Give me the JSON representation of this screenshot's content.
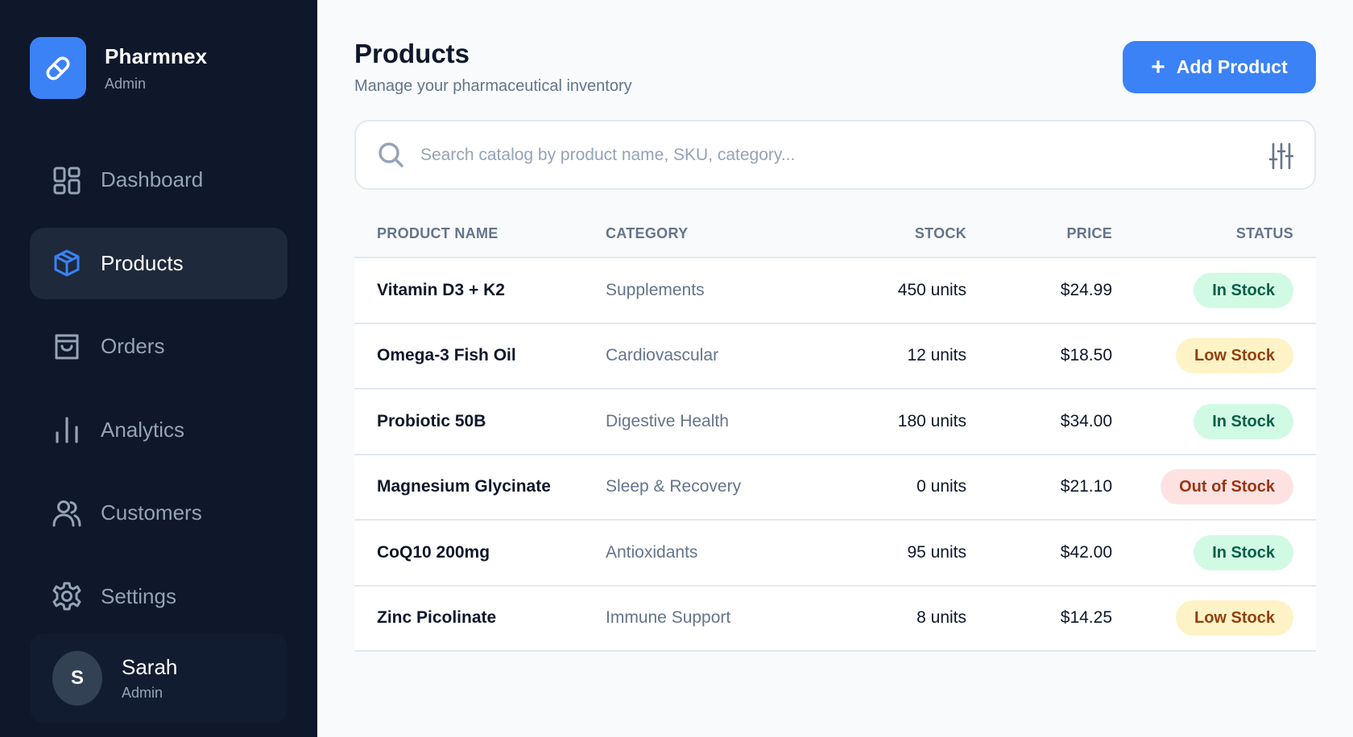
{
  "brand": {
    "name": "Pharmnex",
    "role": "Admin"
  },
  "nav": [
    {
      "label": "Dashboard",
      "icon": "dashboard-icon",
      "active": false
    },
    {
      "label": "Products",
      "icon": "box-icon",
      "active": true
    },
    {
      "label": "Orders",
      "icon": "shopping-bag-icon",
      "active": false
    },
    {
      "label": "Analytics",
      "icon": "bar-chart-icon",
      "active": false
    },
    {
      "label": "Customers",
      "icon": "users-icon",
      "active": false
    },
    {
      "label": "Settings",
      "icon": "gear-icon",
      "active": false
    }
  ],
  "user": {
    "initial": "S",
    "name": "Sarah",
    "role": "Admin"
  },
  "header": {
    "title": "Products",
    "subtitle": "Manage your pharmaceutical inventory",
    "add_button": "Add Product"
  },
  "search": {
    "placeholder": "Search catalog by product name, SKU, category...",
    "value": ""
  },
  "table": {
    "columns": [
      "PRODUCT NAME",
      "CATEGORY",
      "STOCK",
      "PRICE",
      "STATUS"
    ],
    "rows": [
      {
        "name": "Vitamin D3 + K2",
        "category": "Supplements",
        "stock": "450 units",
        "price": "$24.99",
        "status": "In Stock",
        "status_type": "in"
      },
      {
        "name": "Omega-3 Fish Oil",
        "category": "Cardiovascular",
        "stock": "12 units",
        "price": "$18.50",
        "status": "Low Stock",
        "status_type": "low"
      },
      {
        "name": "Probiotic 50B",
        "category": "Digestive Health",
        "stock": "180 units",
        "price": "$34.00",
        "status": "In Stock",
        "status_type": "in"
      },
      {
        "name": "Magnesium Glycinate",
        "category": "Sleep & Recovery",
        "stock": "0 units",
        "price": "$21.10",
        "status": "Out of Stock",
        "status_type": "out"
      },
      {
        "name": "CoQ10 200mg",
        "category": "Antioxidants",
        "stock": "95 units",
        "price": "$42.00",
        "status": "In Stock",
        "status_type": "in"
      },
      {
        "name": "Zinc Picolinate",
        "category": "Immune Support",
        "stock": "8 units",
        "price": "$14.25",
        "status": "Low Stock",
        "status_type": "low"
      }
    ]
  },
  "colors": {
    "sidebar_bg": "#0f172a",
    "accent": "#3b82f6",
    "in_stock_bg": "#d1fae5",
    "low_stock_bg": "#fef3c7",
    "out_of_stock_bg": "#fee2e2"
  }
}
